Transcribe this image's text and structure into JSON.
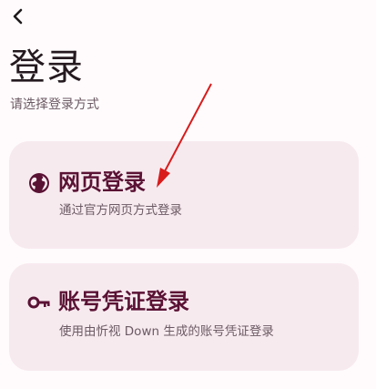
{
  "header": {
    "back_icon": "chevron-left-icon",
    "title": "登录",
    "subtitle": "请选择登录方式"
  },
  "options": [
    {
      "icon": "globe-icon",
      "title": "网页登录",
      "description": "通过官方网页方式登录"
    },
    {
      "icon": "key-icon",
      "title": "账号凭证登录",
      "description": "使用由忻视 Down 生成的账号凭证登录"
    }
  ],
  "colors": {
    "background": "#fffbfc",
    "card_background": "#f7eaef",
    "accent": "#5a1234",
    "annotation_arrow": "#d81c1c"
  }
}
